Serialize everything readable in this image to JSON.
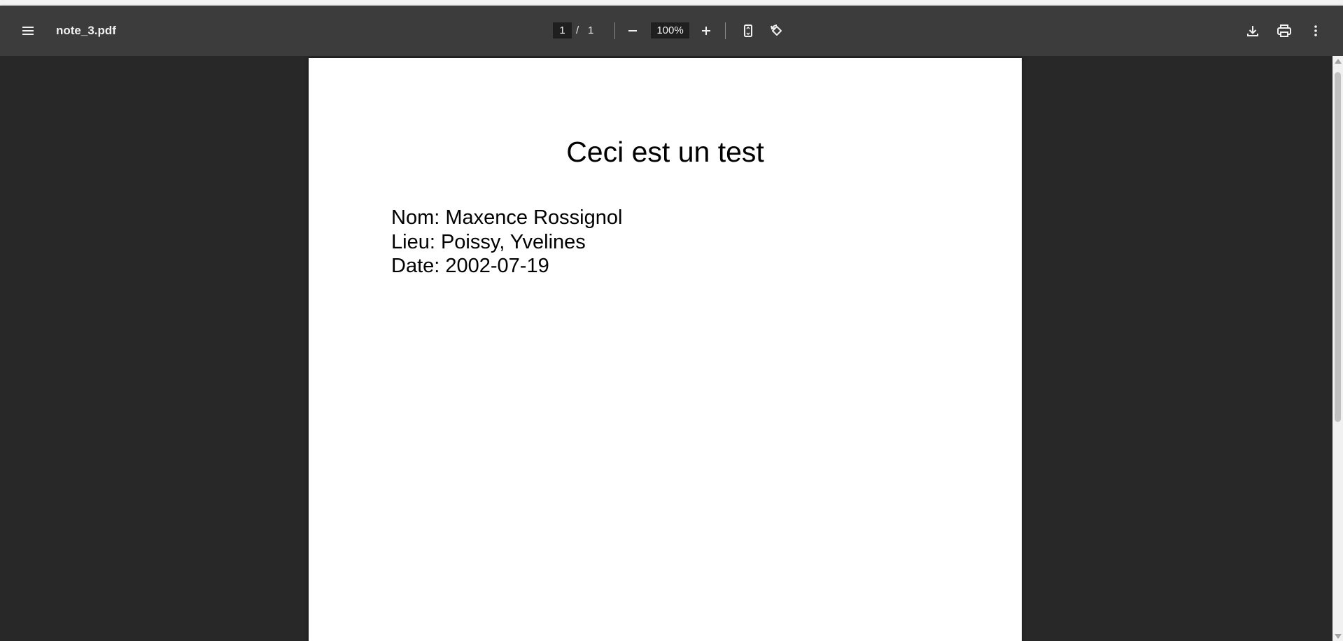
{
  "toolbar": {
    "filename": "note_3.pdf",
    "current_page": "1",
    "page_separator": "/",
    "total_pages": "1",
    "zoom": "100%",
    "icons": {
      "menu": "hamburger-menu-icon",
      "zoom_out": "minus-icon",
      "zoom_in": "plus-icon",
      "fit": "fit-page-icon",
      "rotate": "rotate-counterclockwise-icon",
      "download": "download-icon",
      "print": "print-icon",
      "more": "more-vertical-icon"
    }
  },
  "document": {
    "title": "Ceci est un test",
    "lines": [
      "Nom: Maxence Rossignol",
      "Lieu: Poissy, Yvelines",
      "Date: 2002-07-19"
    ]
  },
  "colors": {
    "toolbar_bg": "#3c3c3c",
    "viewer_bg": "#282828",
    "page_bg": "#ffffff"
  }
}
